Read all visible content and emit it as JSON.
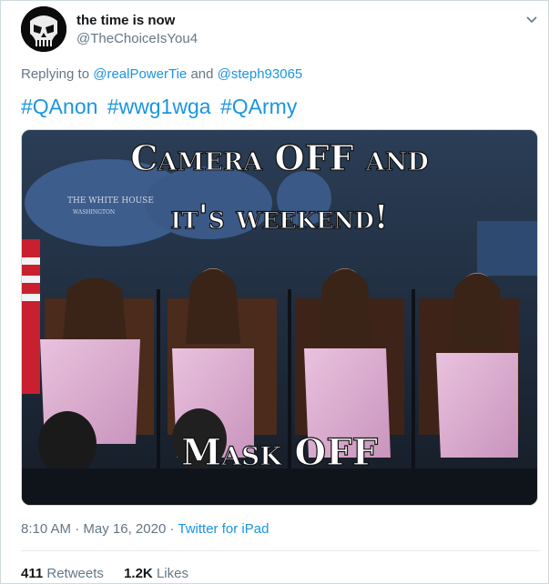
{
  "tweet": {
    "display_name": "the time is now",
    "handle": "@TheChoiceIsYou4",
    "avatar_icon": "skull-icon",
    "replying_prefix": "Replying to",
    "reply_mentions": [
      "@realPowerTie",
      "@steph93065"
    ],
    "reply_conjunction": "and",
    "hashtags": [
      "#QAnon",
      "#wwg1wga",
      "#QArmy"
    ],
    "media": {
      "caption_line1": "Camera OFF and",
      "caption_line2": "it's weekend!",
      "caption_line3": "Mask OFF",
      "podium_text": "THE WHITE HOUSE",
      "podium_subtext": "WASHINGTON"
    },
    "time": "8:10 AM",
    "date": "May 16, 2020",
    "separator": "·",
    "source": "Twitter for iPad",
    "retweets_count": "411",
    "retweets_label": "Retweets",
    "likes_count": "1.2K",
    "likes_label": "Likes"
  },
  "colors": {
    "link": "#1b95e0",
    "secondary_text": "#657786",
    "primary_text": "#14171a"
  }
}
